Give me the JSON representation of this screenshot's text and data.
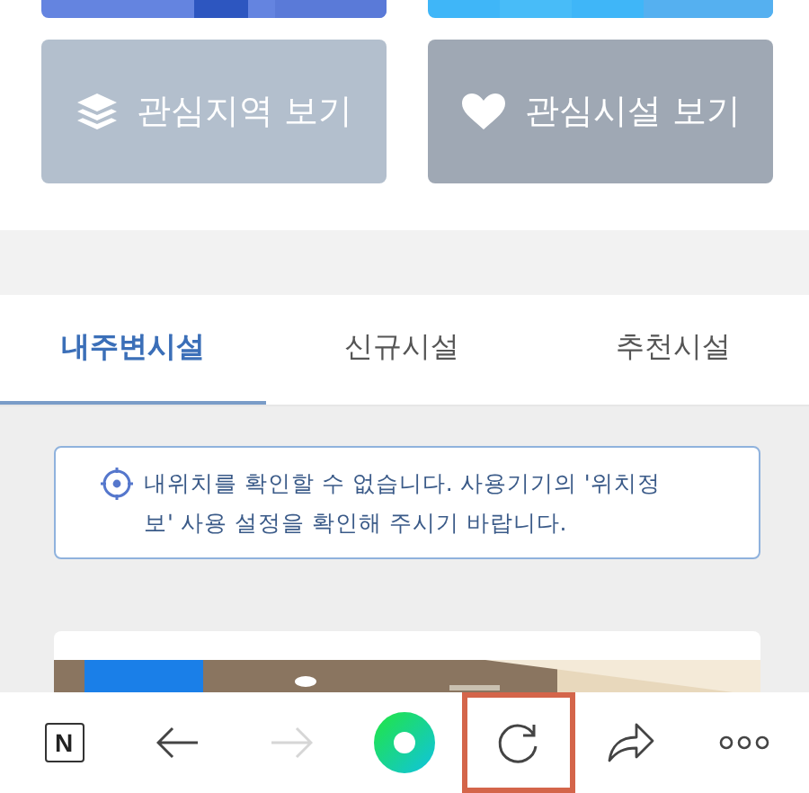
{
  "shortcut_buttons": [
    {
      "label": "관심지역 보기",
      "kind": "layers",
      "color": "#b3bfcd"
    },
    {
      "label": "관심시설 보기",
      "kind": "heart",
      "color": "#9fa8b4"
    }
  ],
  "tabs": [
    {
      "label": "내주변시설",
      "selected": true
    },
    {
      "label": "신규시설",
      "selected": false
    },
    {
      "label": "추천시설",
      "selected": false
    }
  ],
  "notice": {
    "text": "내위치를 확인할 수 없습니다. 사용기기의 '위치정보' 사용 설정을 확인해 주시기 바랍니다."
  },
  "toolbar": [
    {
      "kind": "logo",
      "label": "N",
      "disabled": false,
      "highlighted": false
    },
    {
      "kind": "back",
      "disabled": false,
      "highlighted": false
    },
    {
      "kind": "forward",
      "disabled": true,
      "highlighted": false
    },
    {
      "kind": "home",
      "disabled": false,
      "highlighted": false
    },
    {
      "kind": "refresh",
      "disabled": false,
      "highlighted": true
    },
    {
      "kind": "share",
      "disabled": false,
      "highlighted": false
    },
    {
      "kind": "more",
      "disabled": false,
      "highlighted": false
    }
  ]
}
